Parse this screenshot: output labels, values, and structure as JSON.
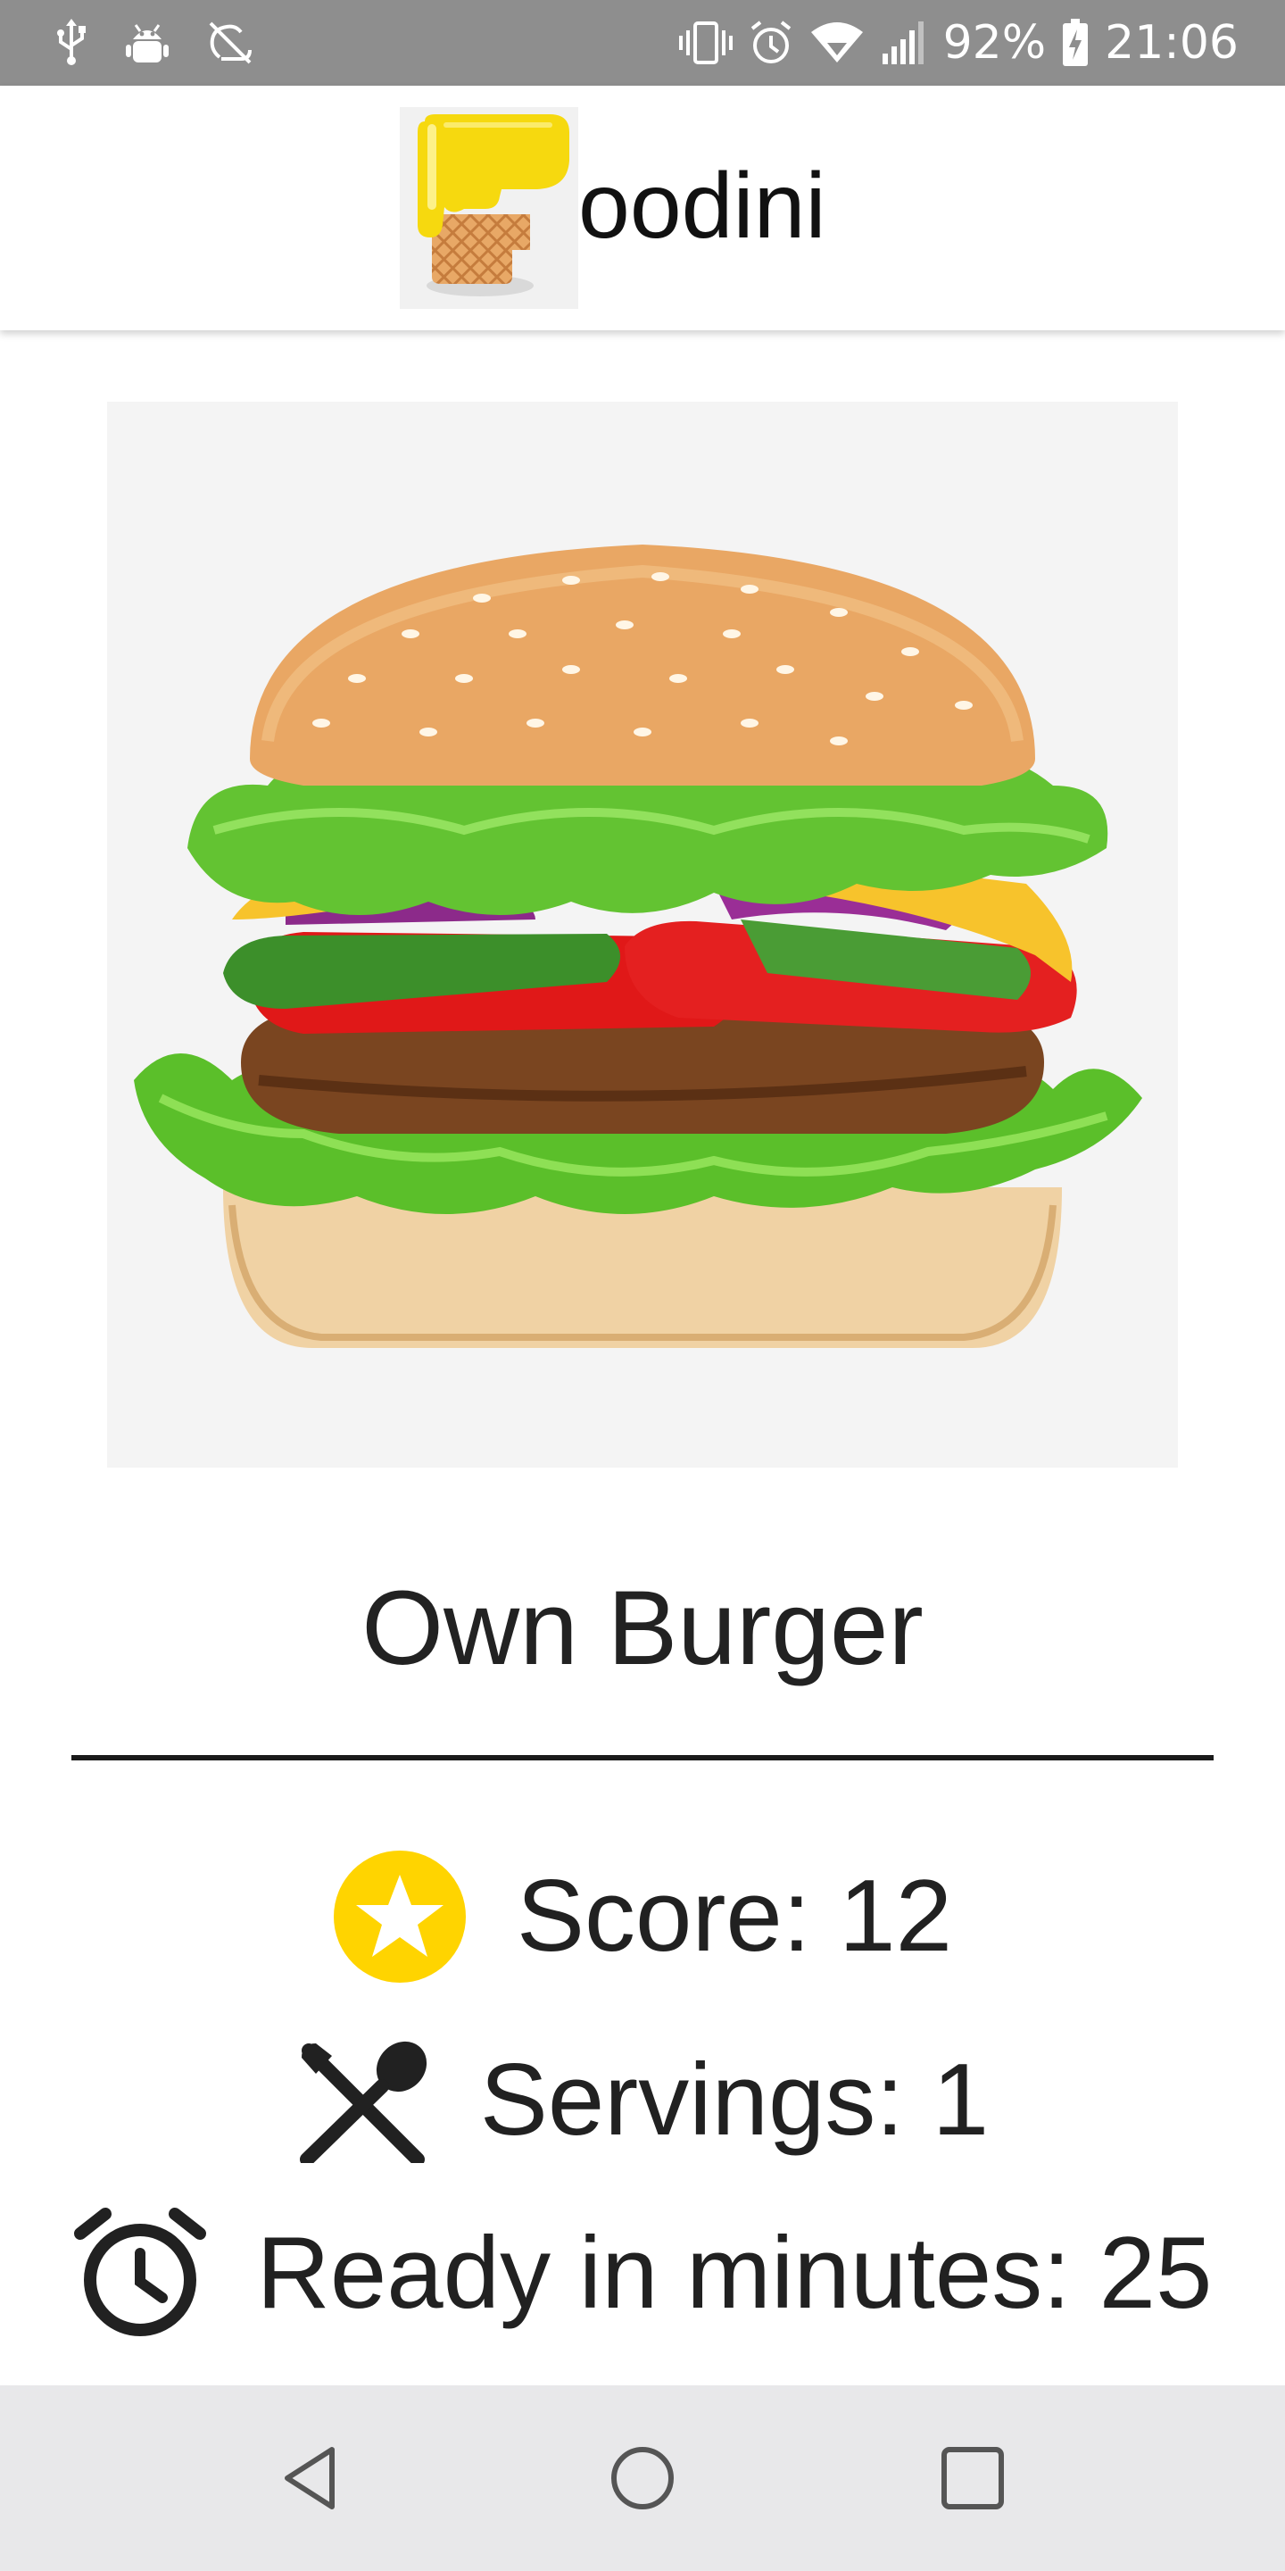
{
  "status_bar": {
    "left_icons": [
      "usb-icon",
      "android-debug-icon",
      "sync-off-icon"
    ],
    "right_icons": [
      "vibrate-icon",
      "alarm-icon",
      "wifi-icon",
      "signal-icon",
      "battery-charging-icon"
    ],
    "battery": "92%",
    "time": "21:06"
  },
  "app_bar": {
    "logo_letter": "F",
    "title": "oodini"
  },
  "recipe": {
    "image_icon": "burger-photo",
    "title": "Own Burger",
    "score_label": "Score: 12",
    "servings_label": "Servings: 1",
    "ready_label": "Ready in minutes: 25"
  },
  "icons": {
    "score": "star-badge-icon",
    "servings": "utensils-icon",
    "ready": "alarm-clock-icon"
  },
  "colors": {
    "status_bar": "#8e8e8e",
    "star_badge": "#ffd400",
    "logo_yellow": "#f6d90f",
    "nav_bar": "#e8e8ea"
  },
  "nav_bar": {
    "buttons": [
      "back-icon",
      "home-icon",
      "recents-icon"
    ]
  }
}
